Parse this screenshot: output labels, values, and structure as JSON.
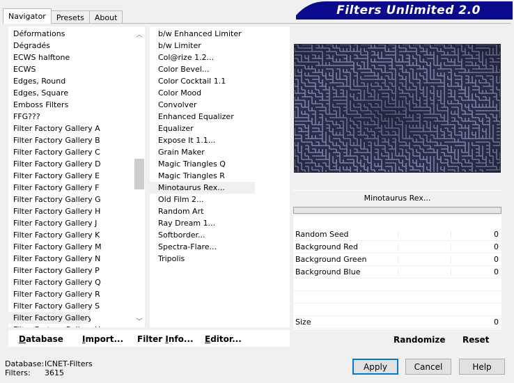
{
  "tabs": [
    {
      "label": "Navigator",
      "active": true
    },
    {
      "label": "Presets",
      "active": false
    },
    {
      "label": "About",
      "active": false
    }
  ],
  "banner": {
    "title": "Filters Unlimited 2.0",
    "color": "#0a0a8c"
  },
  "categories": [
    "Déformations",
    "Dégradés",
    "ECWS halftone",
    "ECWS",
    "Edges, Round",
    "Edges, Square",
    "Emboss Filters",
    "FFG???",
    "Filter Factory Gallery A",
    "Filter Factory Gallery B",
    "Filter Factory Gallery C",
    "Filter Factory Gallery D",
    "Filter Factory Gallery E",
    "Filter Factory Gallery F",
    "Filter Factory Gallery G",
    "Filter Factory Gallery H",
    "Filter Factory Gallery J",
    "Filter Factory Gallery K",
    "Filter Factory Gallery M",
    "Filter Factory Gallery N",
    "Filter Factory Gallery P",
    "Filter Factory Gallery Q",
    "Filter Factory Gallery R",
    "Filter Factory Gallery S",
    "Filter Factory Gallery T",
    "Filter Factory Gallery U"
  ],
  "selected_category": "Filter Factory Gallery T",
  "filters": [
    "b/w Enhanced Limiter",
    "b/w Limiter",
    "Col@rize 1.2...",
    "Color Bevel...",
    "Color Cocktail 1.1",
    "Color Mood",
    "Convolver",
    "Enhanced Equalizer",
    "Equalizer",
    "Expose It 1.1...",
    "Grain Maker",
    "Magic Triangles Q",
    "Magic Triangles R",
    "Minotaurus Rex...",
    "Old Film 2...",
    "Random Art",
    "Ray Dream 1...",
    "Softborder...",
    "Spectra-Flare...",
    "Tripolis"
  ],
  "selected_filter": "Minotaurus Rex...",
  "list_buttons": {
    "database": {
      "u": "D",
      "rest": "atabase"
    },
    "import": {
      "u": "I",
      "rest": "mport..."
    },
    "filter_info": {
      "pre": "Filter ",
      "u": "I",
      "rest": "nfo..."
    },
    "editor": {
      "u": "E",
      "rest": "ditor..."
    }
  },
  "current_filter_name": "Minotaurus Rex...",
  "parameters": [
    {
      "label": "Random Seed",
      "value": "0"
    },
    {
      "label": "Background Red",
      "value": "0"
    },
    {
      "label": "Background Green",
      "value": "0"
    },
    {
      "label": "Background Blue",
      "value": "0"
    }
  ],
  "size_param": {
    "label": "Size",
    "value": "0"
  },
  "right_buttons": {
    "randomize": "Randomize",
    "reset": "Reset"
  },
  "footer": {
    "database_label": "Database:",
    "database_value": "ICNET-Filters",
    "filters_label": "Filters:",
    "filters_value": "3615"
  },
  "dialog_buttons": {
    "apply": "Apply",
    "cancel": "Cancel",
    "help": "Help"
  }
}
